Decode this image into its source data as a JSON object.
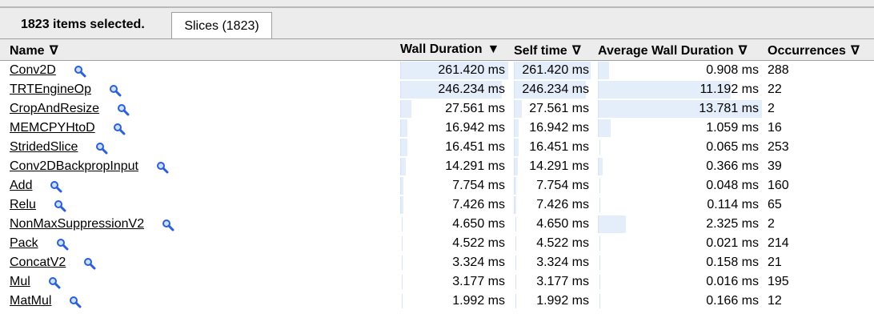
{
  "selection": {
    "summary": "1823 items selected.",
    "tab_label": "Slices (1823)"
  },
  "columns": {
    "name": "Name",
    "name_arrow": "∇",
    "wall": "Wall Duration",
    "wall_arrow": "▼",
    "self": "Self time",
    "self_arrow": "∇",
    "avg": "Average Wall Duration",
    "avg_arrow": "∇",
    "occ": "Occurrences",
    "occ_arrow": "∇"
  },
  "rows": [
    {
      "name": "Conv2D",
      "wall": "261.420 ms",
      "self": "261.420 ms",
      "avg": "0.908 ms",
      "occ": "288",
      "wall_frac": 1.0,
      "self_frac": 1.0,
      "avg_frac": 0.066
    },
    {
      "name": "TRTEngineOp",
      "wall": "246.234 ms",
      "self": "246.234 ms",
      "avg": "11.192 ms",
      "occ": "22",
      "wall_frac": 0.942,
      "self_frac": 0.942,
      "avg_frac": 0.812
    },
    {
      "name": "CropAndResize",
      "wall": "27.561 ms",
      "self": "27.561 ms",
      "avg": "13.781 ms",
      "occ": "2",
      "wall_frac": 0.105,
      "self_frac": 0.105,
      "avg_frac": 1.0
    },
    {
      "name": "MEMCPYHtoD",
      "wall": "16.942 ms",
      "self": "16.942 ms",
      "avg": "1.059 ms",
      "occ": "16",
      "wall_frac": 0.065,
      "self_frac": 0.065,
      "avg_frac": 0.077
    },
    {
      "name": "StridedSlice",
      "wall": "16.451 ms",
      "self": "16.451 ms",
      "avg": "0.065 ms",
      "occ": "253",
      "wall_frac": 0.063,
      "self_frac": 0.063,
      "avg_frac": 0.005
    },
    {
      "name": "Conv2DBackpropInput",
      "wall": "14.291 ms",
      "self": "14.291 ms",
      "avg": "0.366 ms",
      "occ": "39",
      "wall_frac": 0.055,
      "self_frac": 0.055,
      "avg_frac": 0.027
    },
    {
      "name": "Add",
      "wall": "7.754 ms",
      "self": "7.754 ms",
      "avg": "0.048 ms",
      "occ": "160",
      "wall_frac": 0.03,
      "self_frac": 0.03,
      "avg_frac": 0.003
    },
    {
      "name": "Relu",
      "wall": "7.426 ms",
      "self": "7.426 ms",
      "avg": "0.114 ms",
      "occ": "65",
      "wall_frac": 0.028,
      "self_frac": 0.028,
      "avg_frac": 0.008
    },
    {
      "name": "NonMaxSuppressionV2",
      "wall": "4.650 ms",
      "self": "4.650 ms",
      "avg": "2.325 ms",
      "occ": "2",
      "wall_frac": 0.018,
      "self_frac": 0.018,
      "avg_frac": 0.169
    },
    {
      "name": "Pack",
      "wall": "4.522 ms",
      "self": "4.522 ms",
      "avg": "0.021 ms",
      "occ": "214",
      "wall_frac": 0.017,
      "self_frac": 0.017,
      "avg_frac": 0.002
    },
    {
      "name": "ConcatV2",
      "wall": "3.324 ms",
      "self": "3.324 ms",
      "avg": "0.158 ms",
      "occ": "21",
      "wall_frac": 0.013,
      "self_frac": 0.013,
      "avg_frac": 0.011
    },
    {
      "name": "Mul",
      "wall": "3.177 ms",
      "self": "3.177 ms",
      "avg": "0.016 ms",
      "occ": "195",
      "wall_frac": 0.012,
      "self_frac": 0.012,
      "avg_frac": 0.001
    },
    {
      "name": "MatMul",
      "wall": "1.992 ms",
      "self": "1.992 ms",
      "avg": "0.166 ms",
      "occ": "12",
      "wall_frac": 0.008,
      "self_frac": 0.008,
      "avg_frac": 0.012
    }
  ],
  "icons": {
    "row_action": "magnifier-icon"
  },
  "colors": {
    "bar_fill": "#e4edfa",
    "bar_edge": "#d6e2f5",
    "icon_blue": "#2a5fd8"
  }
}
